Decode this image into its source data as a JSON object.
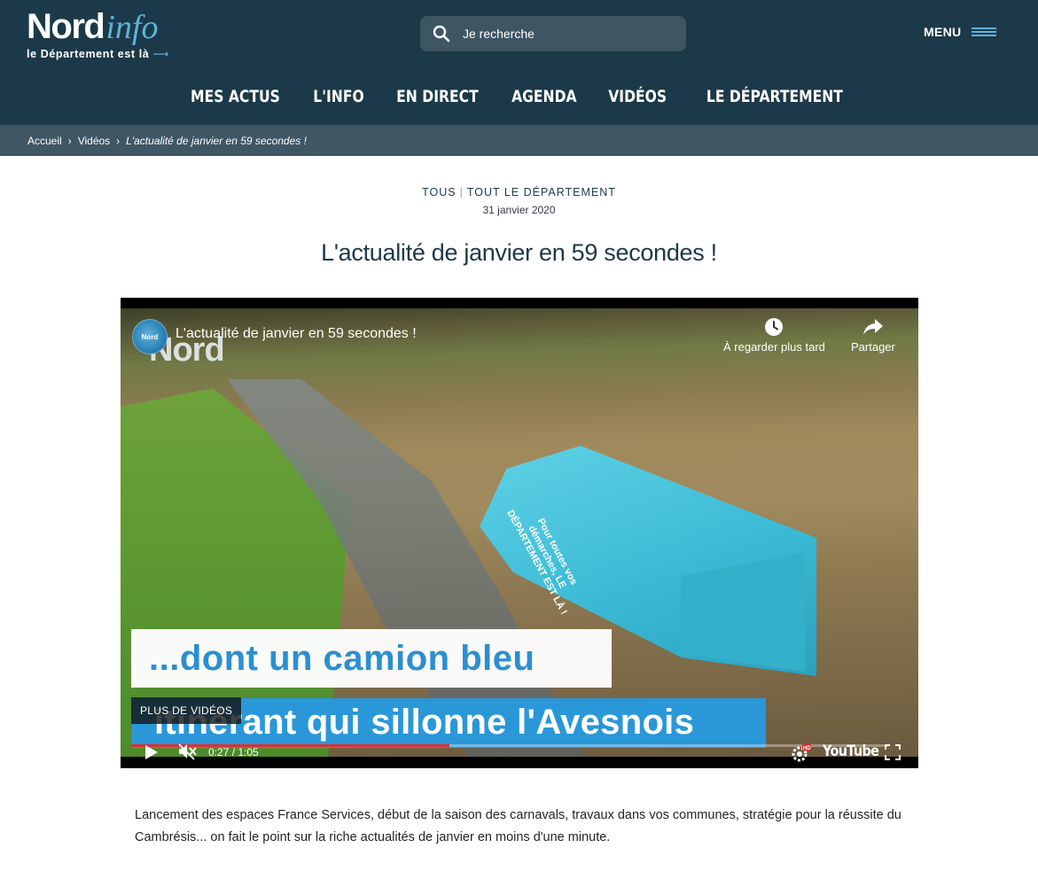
{
  "header": {
    "logo": {
      "main": "Nord",
      "accent": "info",
      "tagline": "le Département est là"
    },
    "search": {
      "placeholder": "Je recherche"
    },
    "menu_label": "MENU",
    "nav": [
      "MES ACTUS",
      "L'INFO",
      "EN DIRECT",
      "AGENDA",
      "VIDÉOS",
      "LE DÉPARTEMENT"
    ]
  },
  "breadcrumb": {
    "home": "Accueil",
    "section": "Vidéos",
    "current": "L'actualité de janvier en 59 secondes !"
  },
  "article": {
    "categories": [
      "TOUS",
      "TOUT LE DÉPARTEMENT"
    ],
    "date": "31 janvier 2020",
    "title": "L'actualité de janvier en 59 secondes !",
    "description": "Lancement des espaces France Services, début de la saison des carnavals, travaux dans vos communes, stratégie pour la réussite du Cambrésis... on fait le point sur la riche actualités de janvier en moins d'une minute."
  },
  "video": {
    "channel_badge": "Nord",
    "title": "L'actualité de janvier en 59 secondes !",
    "watch_later": "À regarder plus tard",
    "share": "Partager",
    "watermark": "Nord",
    "truck_text": "Pour toutes vos démarches, LE DÉPARTEMENT EST LÀ !",
    "caption_line1": "...dont un camion bleu",
    "caption_line2": "itinérant qui sillonne l'Avesnois",
    "more_videos": "PLUS DE VIDÉOS",
    "current_time": "0:27 / 1:05",
    "progress_fraction": 0.42,
    "brand": "YouTube"
  },
  "colors": {
    "header_bg": "#1c3949",
    "breadcrumb_bg": "#3f5664",
    "accent": "#5fb2da",
    "progress": "#e32d2d"
  }
}
